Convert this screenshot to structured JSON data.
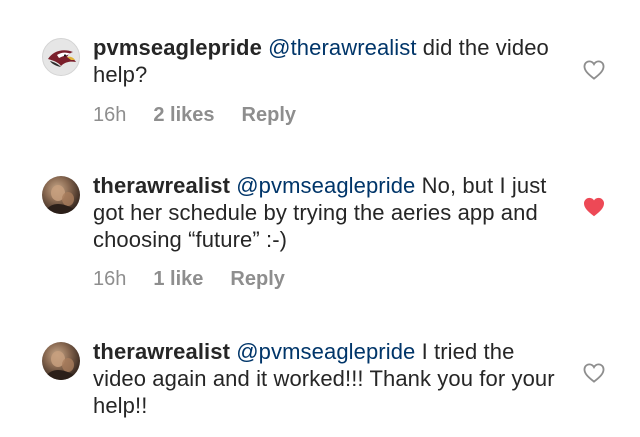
{
  "colors": {
    "text": "#262626",
    "mention": "#003569",
    "meta": "#8e8e8e",
    "liked_heart": "#ed4956",
    "outline_heart": "#8e8e8e"
  },
  "comments": [
    {
      "username": "pvmseaglepride",
      "mention": "@therawrealist",
      "text": " did the video help?",
      "time": "16h",
      "likes": "2 likes",
      "reply_label": "Reply",
      "liked": false,
      "avatar_icon": "eagle-avatar-icon",
      "heart_icon": "heart-outline-icon"
    },
    {
      "username": "therawrealist",
      "mention": "@pvmseaglepride",
      "text": " No, but I just got her schedule by trying the aeries app and choosing “future” :-)",
      "time": "16h",
      "likes": "1 like",
      "reply_label": "Reply",
      "liked": true,
      "avatar_icon": "profile-photo-avatar",
      "heart_icon": "heart-filled-icon"
    },
    {
      "username": "therawrealist",
      "mention": "@pvmseaglepride",
      "text": " I tried the video again and it worked!!! Thank you for your help!!",
      "liked": false,
      "avatar_icon": "profile-photo-avatar",
      "heart_icon": "heart-outline-icon"
    }
  ]
}
